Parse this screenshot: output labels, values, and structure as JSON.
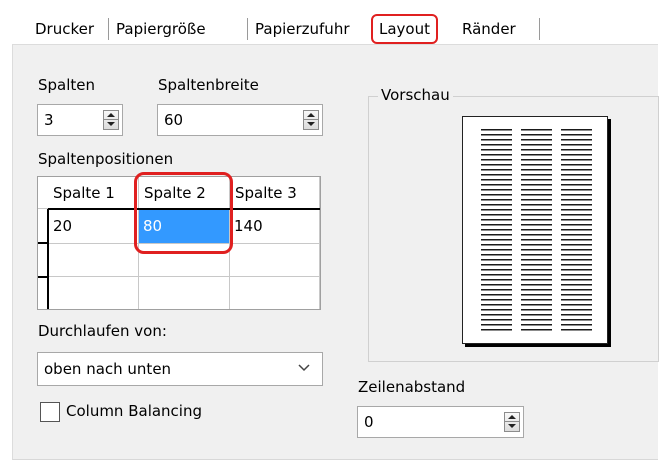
{
  "tabs": [
    {
      "label": "Drucker"
    },
    {
      "label": "Papiergröße"
    },
    {
      "label": "Papierzufuhr"
    },
    {
      "label": "Layout"
    },
    {
      "label": "Ränder"
    }
  ],
  "columns": {
    "label": "Spalten",
    "value": "3"
  },
  "column_width": {
    "label": "Spaltenbreite",
    "value": "60"
  },
  "column_positions": {
    "label": "Spaltenpositionen",
    "headers": [
      "Spalte 1",
      "Spalte 2",
      "Spalte 3"
    ],
    "rows": [
      [
        "20",
        "80",
        "140"
      ]
    ],
    "selected_color": "#3399ff"
  },
  "run_order": {
    "label": "Durchlaufen von:",
    "value": "oben nach unten"
  },
  "column_balancing": {
    "label": "Column Balancing",
    "checked": false
  },
  "preview": {
    "title": "Vorschau"
  },
  "line_spacing": {
    "label": "Zeilenabstand",
    "value": "0"
  },
  "highlight_color": "#e02020"
}
